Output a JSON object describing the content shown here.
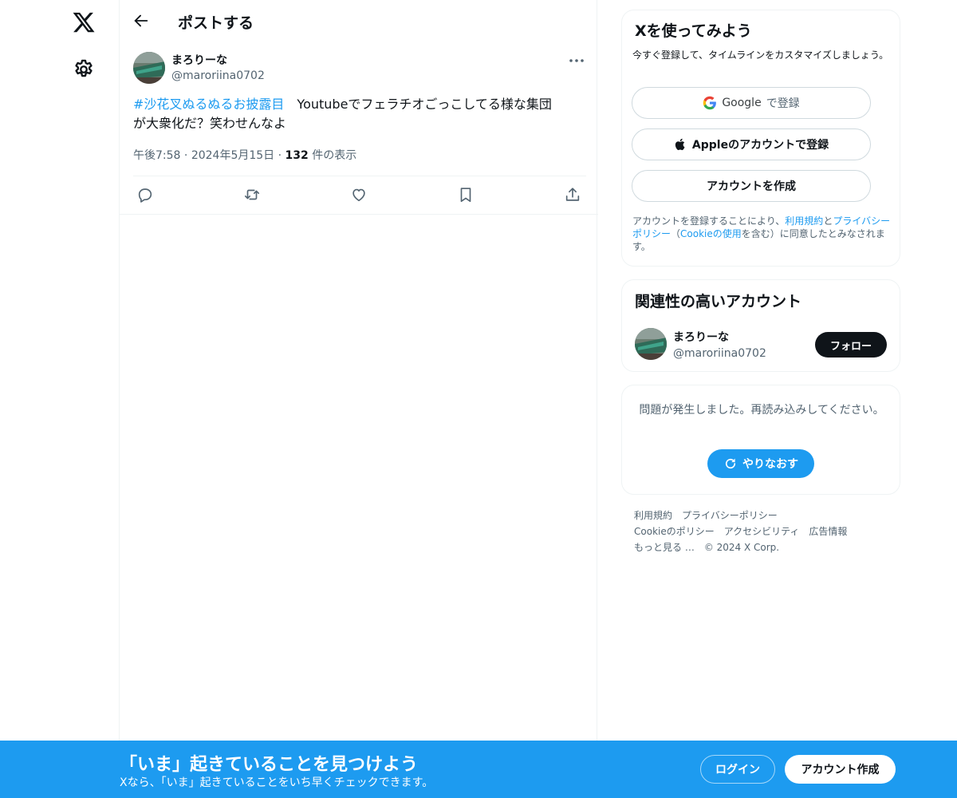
{
  "nav": {
    "logo_icon": "x-logo-icon",
    "settings_icon": "gear-icon"
  },
  "header": {
    "back_icon": "arrow-left-icon",
    "title": "ポストする"
  },
  "post": {
    "author_name": "まろりーな",
    "author_handle": "@maroriina0702",
    "more_icon": "more-horizontal-icon",
    "hashtag": "#沙花叉ぬるぬるお披露目",
    "body_line1": "　Youtubeでフェラチオごっこしてる様な集団",
    "body_line2": "が大衆化だ？笑わせんなよ",
    "time": "午後7:58",
    "separator": "·",
    "date": "2024年5月15日",
    "views_count": "132",
    "views_label": "件の表示",
    "actions": [
      "reply-icon",
      "repost-icon",
      "like-icon",
      "bookmark-icon",
      "share-icon"
    ]
  },
  "signup": {
    "title": "Xを使ってみよう",
    "subtitle": "今すぐ登録して、タイムラインをカスタマイズしましょう。",
    "google_label": "Google",
    "google_suffix": "で登録",
    "apple_label": "Appleのアカウントで登録",
    "create_label": "アカウントを作成",
    "terms_1": "アカウントを登録することにより、",
    "terms_link1": "利用規約",
    "terms_2": "と",
    "terms_link2": "プライバシーポリシー",
    "terms_3": "（",
    "terms_link3": "Cookieの使用",
    "terms_4": "を含む）に同意したとみなされます。"
  },
  "related": {
    "title": "関連性の高いアカウント",
    "name": "まろりーな",
    "handle": "@maroriina0702",
    "follow_label": "フォロー"
  },
  "error": {
    "message": "問題が発生しました。再読み込みしてください。",
    "retry_label": "やりなおす"
  },
  "footer": {
    "links": [
      "利用規約",
      "プライバシーポリシー",
      "Cookieのポリシー",
      "アクセシビリティ",
      "広告情報",
      "もっと見る …"
    ],
    "copyright": "© 2024 X Corp."
  },
  "banner": {
    "title": "「いま」起きていることを見つけよう",
    "subtitle": "Xなら、「いま」起きていることをいち早くチェックできます。",
    "login_label": "ログイン",
    "create_label": "アカウント作成"
  },
  "colors": {
    "accent": "#1d9bf0",
    "text": "#0f1419",
    "secondary": "#536471",
    "border": "#eff3f4"
  }
}
